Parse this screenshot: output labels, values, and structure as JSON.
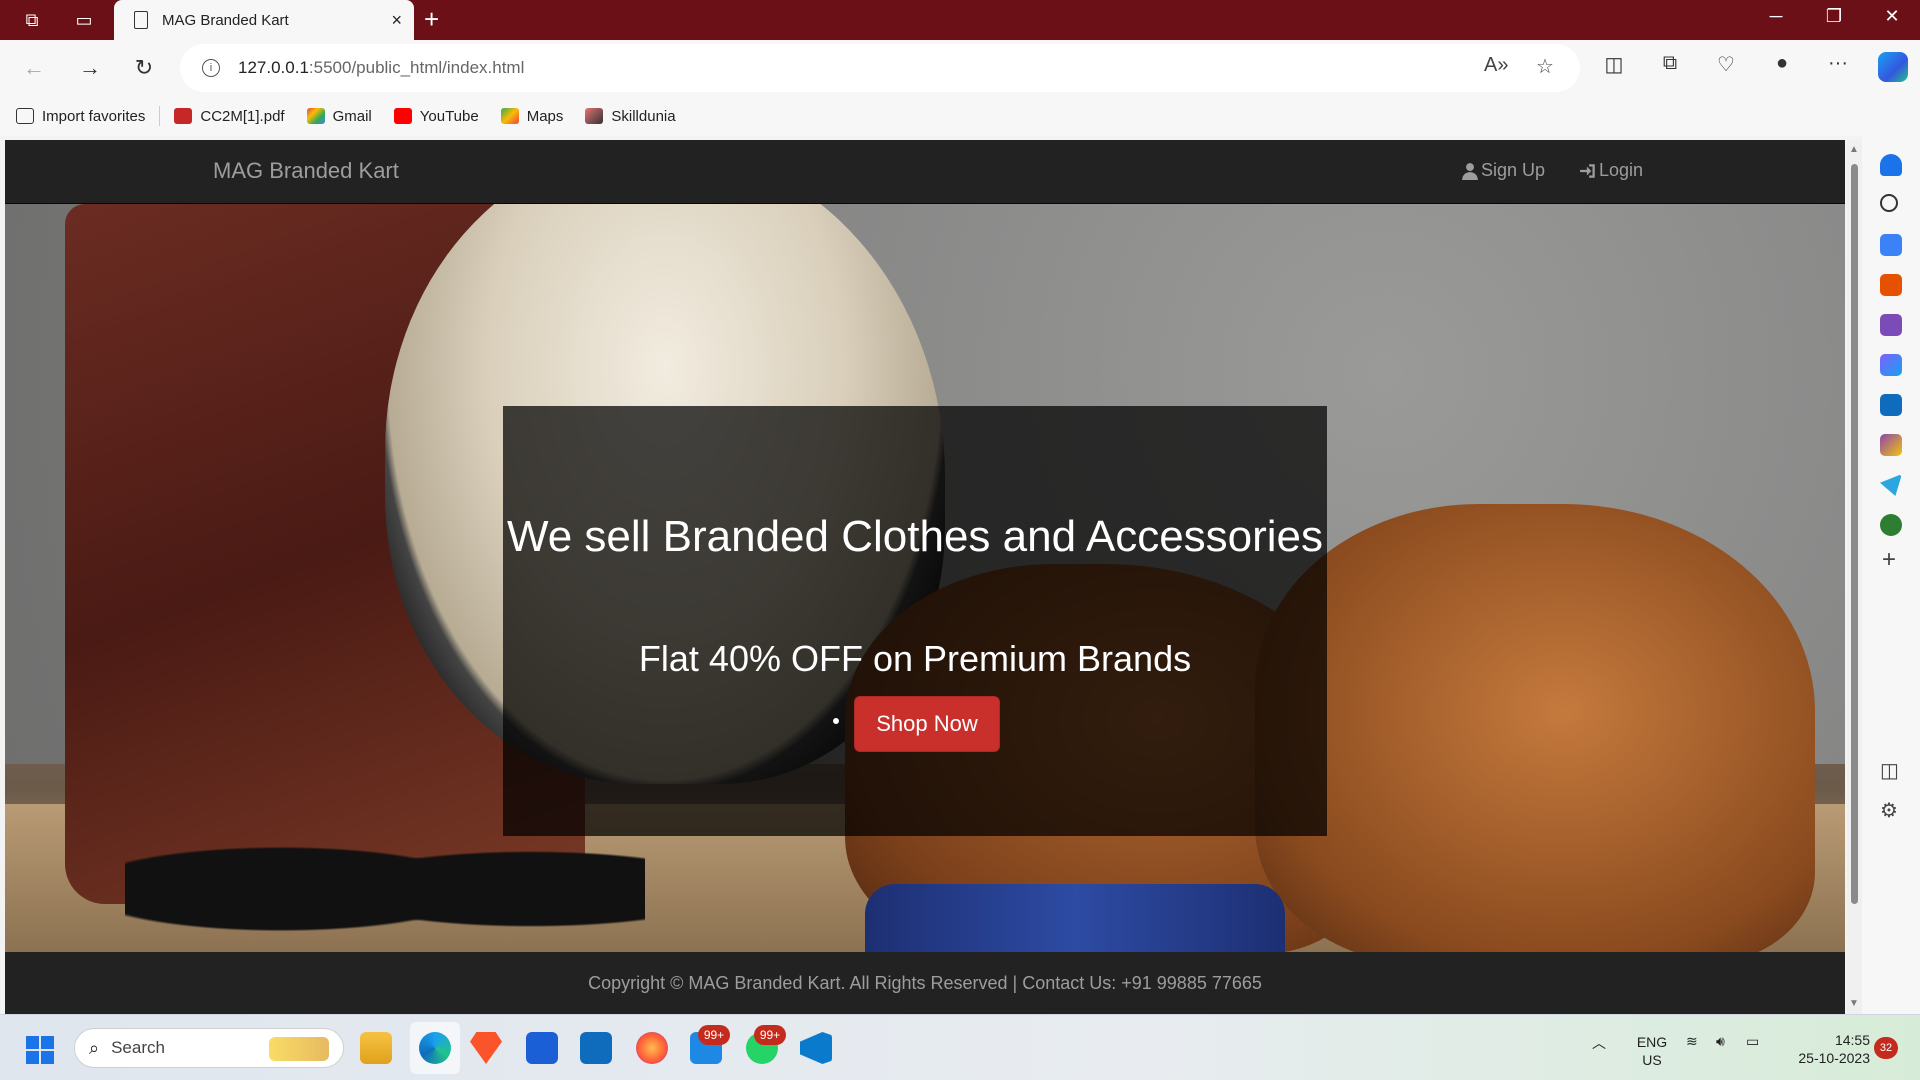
{
  "browser": {
    "tab_title": "MAG Branded Kart",
    "tab_close": "×",
    "new_tab": "+",
    "url_host": "127.0.0.1",
    "url_rest": ":5500/public_html/index.html"
  },
  "bookmarks": [
    {
      "label": "Import favorites",
      "icon": "import-icon"
    },
    {
      "label": "CC2M[1].pdf",
      "icon": "pdf-icon"
    },
    {
      "label": "Gmail",
      "icon": "gmail-icon"
    },
    {
      "label": "YouTube",
      "icon": "youtube-icon"
    },
    {
      "label": "Maps",
      "icon": "maps-icon"
    },
    {
      "label": "Skilldunia",
      "icon": "skilldunia-icon"
    }
  ],
  "site": {
    "brand": "MAG Branded Kart",
    "nav": {
      "signup_label": "Sign Up",
      "login_label": "Login"
    },
    "hero": {
      "headline": "We sell Branded Clothes and Accessories",
      "subline": "Flat 40% OFF on Premium Brands",
      "button_label": "Shop Now"
    },
    "footer_text": "Copyright © MAG Branded Kart. All Rights Reserved | Contact Us: +91 99885 77665"
  },
  "taskbar": {
    "search_placeholder": "Search",
    "badge_1": "99+",
    "badge_2": "99+",
    "lang_line1": "ENG",
    "lang_line2": "US",
    "time": "14:55",
    "date": "25-10-2023",
    "notifications": "32"
  },
  "colors": {
    "titlebar": "#6b1016",
    "site_nav_bg": "#222222",
    "button_red": "#c9302c"
  }
}
